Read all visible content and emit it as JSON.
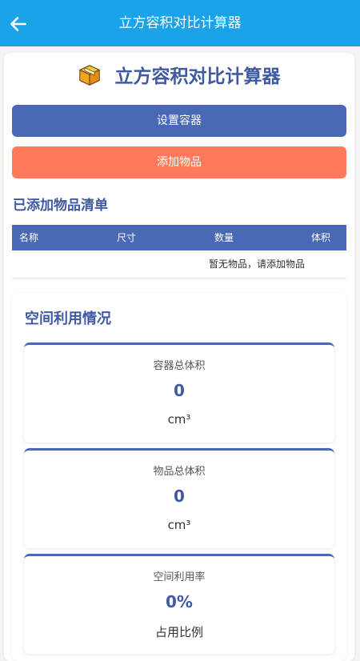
{
  "topbar": {
    "title": "立方容积对比计算器",
    "back_icon": "arrow-left-icon"
  },
  "header": {
    "title": "立方容积对比计算器",
    "icon": "box-icon"
  },
  "buttons": {
    "set_container": "设置容器",
    "add_item": "添加物品"
  },
  "items_section": {
    "title": "已添加物品清单",
    "columns": [
      "名称",
      "尺寸",
      "数量",
      "体积"
    ],
    "empty_message": "暂无物品，请添加物品"
  },
  "usage": {
    "title": "空间利用情况",
    "stats": [
      {
        "label": "容器总体积",
        "value": "0",
        "unit": "cm³"
      },
      {
        "label": "物品总体积",
        "value": "0",
        "unit": "cm³"
      },
      {
        "label": "空间利用率",
        "value": "0%",
        "unit": "占用比例"
      }
    ]
  },
  "colors": {
    "topbar": "#1aa3e8",
    "primary": "#4a69b4",
    "secondary": "#ff7a5a",
    "heading": "#3f5aa2"
  }
}
